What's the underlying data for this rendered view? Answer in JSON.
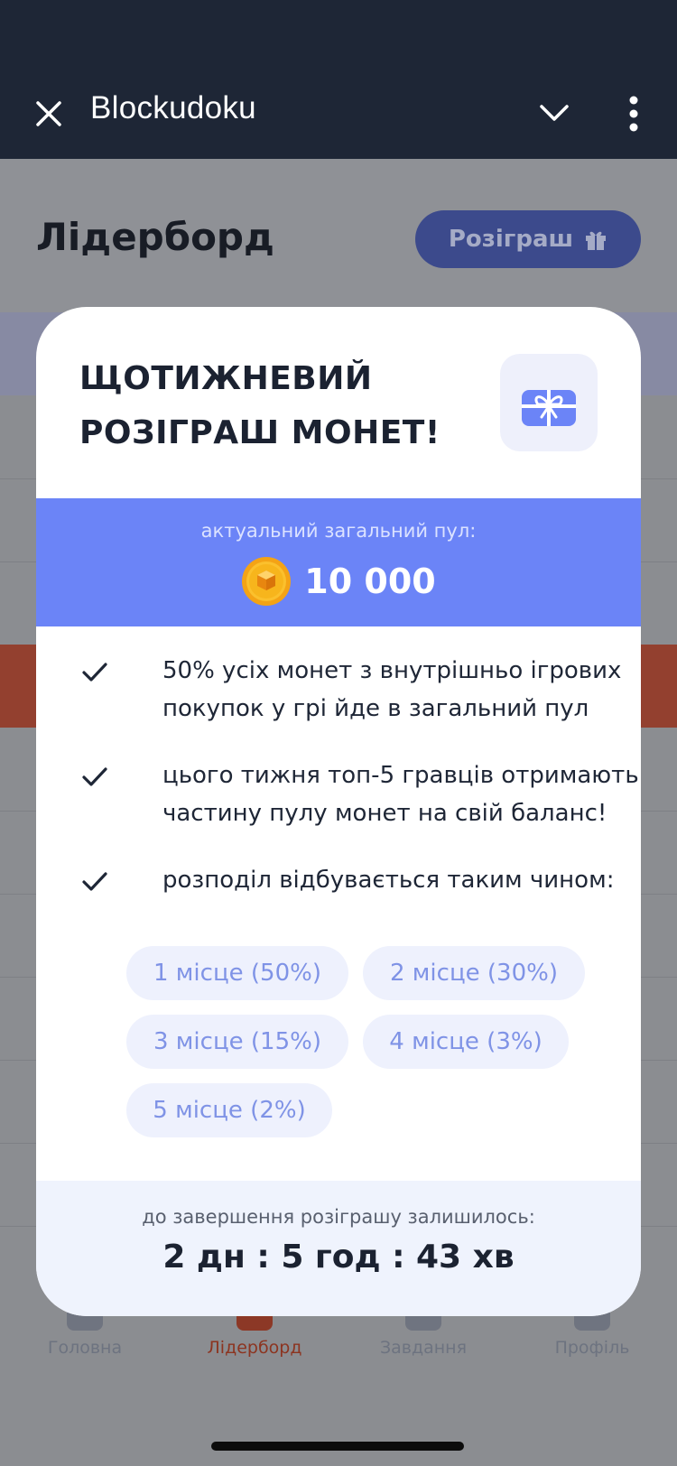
{
  "app_bar": {
    "title": "Blockudoku",
    "close_icon": "close-icon",
    "collapse_icon": "chevron-down-icon",
    "menu_icon": "more-vertical-icon"
  },
  "page": {
    "title": "Лідерборд",
    "draw_button_label": "Розіграш",
    "tabs": [
      {
        "label": "Головна",
        "icon": "home-icon"
      },
      {
        "label": "Лідерборд",
        "icon": "trophy-icon",
        "active": true
      },
      {
        "label": "Завдання",
        "icon": "tasks-icon"
      },
      {
        "label": "Профіль",
        "icon": "profile-icon"
      }
    ]
  },
  "modal": {
    "title_line1": "ЩОТИЖНЕВИЙ",
    "title_line2": "РОЗІГРАШ МОНЕТ!",
    "gift_icon": "gift-icon",
    "pool": {
      "label": "актуальний загальний пул:",
      "value": "10 000",
      "icon": "coin-icon"
    },
    "rules": [
      {
        "line1": "50% усіх монет з внутрішньо ігрових",
        "line2": "покупок у грі йде в загальний пул"
      },
      {
        "line1": "цього тижня топ-5 гравців отримають",
        "line2": "частину пулу монет на свій баланс!"
      },
      {
        "line1": "розподіл відбувається таким чином:"
      }
    ],
    "places": [
      "1 місце (50%)",
      "2 місце (30%)",
      "3 місце (15%)",
      "4 місце (3%)",
      "5 місце (2%)"
    ],
    "countdown": {
      "label": "до завершення розіграшу залишилось:",
      "value": "2 дн : 5 год : 43 хв"
    },
    "colors": {
      "accent": "#6b84f7",
      "chip_bg": "#eef1fd",
      "chip_text": "#7f93e6"
    }
  }
}
